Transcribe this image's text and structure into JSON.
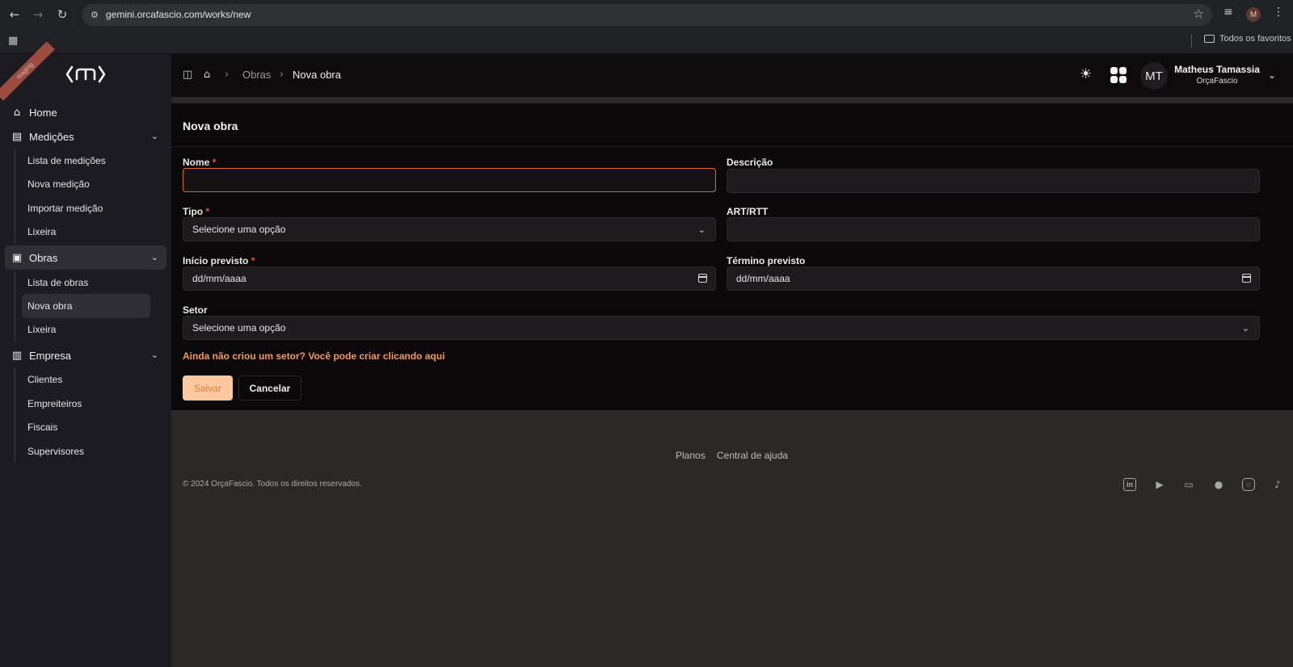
{
  "browser": {
    "url": "gemini.orcafascio.com/works/new",
    "profile_initial": "M",
    "bookmark_folder": "Todos os favoritos"
  },
  "sidebar": {
    "ribbon": "staging",
    "items": [
      {
        "label": "Home",
        "icon": "home-icon"
      },
      {
        "label": "Medições",
        "icon": "calculator-icon",
        "children": [
          "Lista de medições",
          "Nova medição",
          "Importar medição",
          "Lixeira"
        ]
      },
      {
        "label": "Obras",
        "icon": "briefcase-icon",
        "children": [
          "Lista de obras",
          "Nova obra",
          "Lixeira"
        ]
      },
      {
        "label": "Empresa",
        "icon": "building-icon",
        "children": [
          "Clientes",
          "Empreiteiros",
          "Fiscais",
          "Supervisores"
        ]
      }
    ]
  },
  "header": {
    "breadcrumb": [
      "Obras",
      "Nova obra"
    ],
    "user": {
      "initials": "MT",
      "name": "Matheus Tamassia",
      "org": "OrçaFascio"
    }
  },
  "form": {
    "title": "Nova obra",
    "required_mark": "*",
    "fields": {
      "nome": {
        "label": "Nome",
        "value": ""
      },
      "descricao": {
        "label": "Descrição",
        "value": ""
      },
      "tipo": {
        "label": "Tipo",
        "value": "Selecione uma opção"
      },
      "art": {
        "label": "ART/RTT",
        "value": ""
      },
      "inicio": {
        "label": "Início previsto",
        "value": "dd/mm/aaaa"
      },
      "termino": {
        "label": "Término previsto",
        "value": "dd/mm/aaaa"
      },
      "setor": {
        "label": "Setor",
        "value": "Selecione uma opção"
      }
    },
    "hint": "Ainda não criou um setor? Você pode criar clicando aqui",
    "save_label": "Salvar",
    "cancel_label": "Cancelar"
  },
  "footer": {
    "links": [
      "Planos",
      "Central de ajuda"
    ],
    "copyright": "© 2024 OrçaFascio. Todos os direitos reservados.",
    "social": [
      "linkedin-icon",
      "google-play-icon",
      "youtube-icon",
      "facebook-icon",
      "instagram-icon",
      "tiktok-icon"
    ]
  },
  "colors": {
    "accent": "#e06a2a",
    "hint": "#f59a5a",
    "save_bg": "#fbc8a2",
    "required": "#e5563e"
  }
}
